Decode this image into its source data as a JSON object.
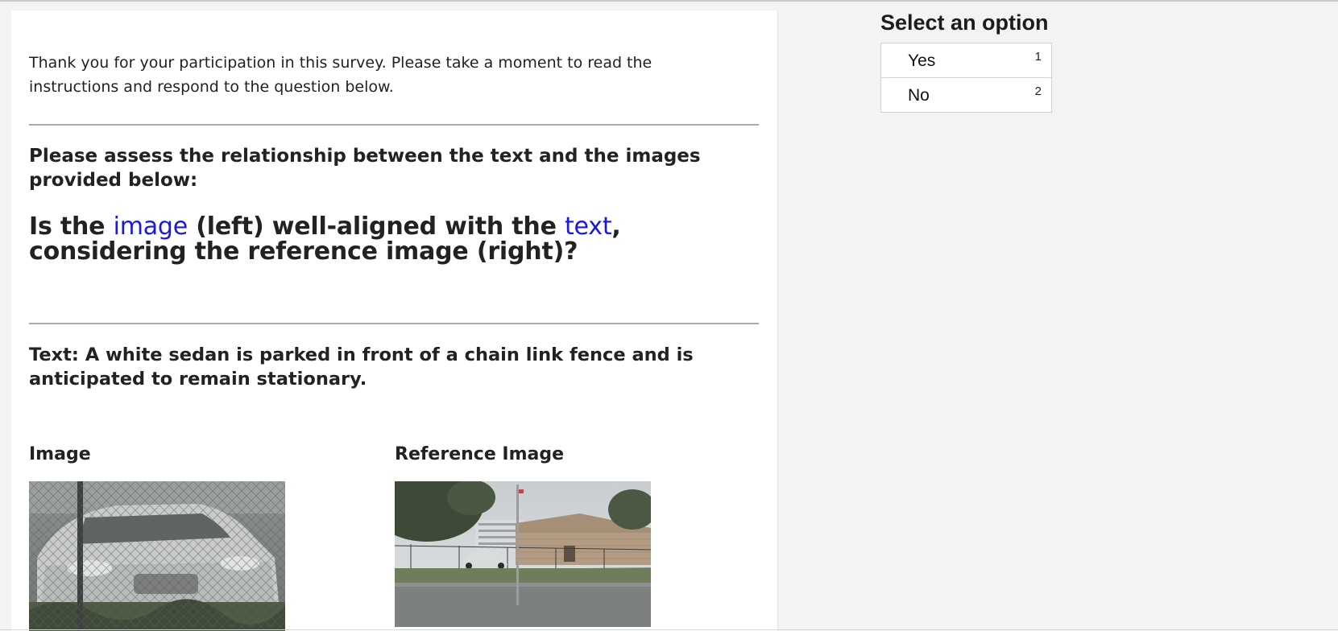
{
  "survey": {
    "intro": "Thank you for your participation in this survey. Please take a moment to read the instructions and respond to the question below.",
    "assess": "Please assess the relationship between the text and the images provided below:",
    "question": {
      "part1": "Is the ",
      "highlight1": "image",
      "part2": " (left) well-aligned with the ",
      "highlight2": "text",
      "part3": ", considering the reference image (right)?"
    },
    "text_line": "Text: A white sedan is parked in front of a chain link fence and is anticipated to remain stationary.",
    "image_label": "Image",
    "reference_label": "Reference Image"
  },
  "sidebar": {
    "title": "Select an option",
    "options": [
      {
        "label": "Yes",
        "key": "1"
      },
      {
        "label": "No",
        "key": "2"
      }
    ]
  },
  "colors": {
    "highlight": "#1a1ad8",
    "background": "#f2f3f2",
    "panel": "#ffffff"
  }
}
